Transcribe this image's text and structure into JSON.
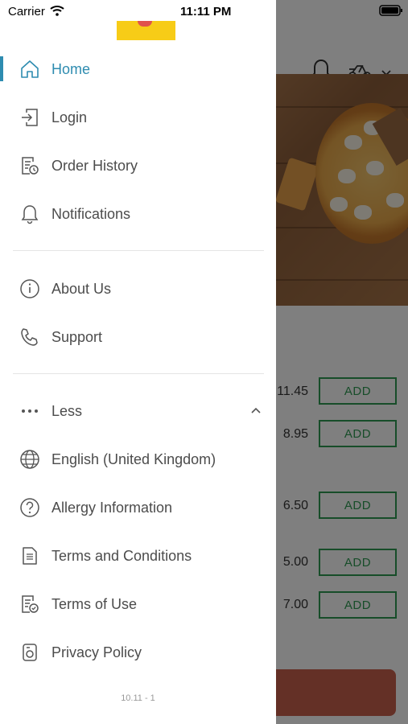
{
  "status_bar": {
    "carrier": "Carrier",
    "time": "11:11 PM"
  },
  "drawer": {
    "primary": [
      {
        "label": "Home",
        "icon": "home-icon",
        "active": true
      },
      {
        "label": "Login",
        "icon": "login-icon"
      },
      {
        "label": "Order History",
        "icon": "order-history-icon"
      },
      {
        "label": "Notifications",
        "icon": "bell-icon"
      }
    ],
    "secondary": [
      {
        "label": "About Us",
        "icon": "info-icon"
      },
      {
        "label": "Support",
        "icon": "phone-icon"
      }
    ],
    "more_toggle": {
      "label": "Less",
      "icon": "ellipsis-icon",
      "expanded": true
    },
    "more_items": [
      {
        "label": "English (United Kingdom)",
        "icon": "globe-icon"
      },
      {
        "label": "Allergy Information",
        "icon": "question-icon"
      },
      {
        "label": "Terms and Conditions",
        "icon": "document-icon"
      },
      {
        "label": "Terms of Use",
        "icon": "document-check-icon"
      },
      {
        "label": "Privacy Policy",
        "icon": "privacy-icon"
      }
    ],
    "version": "10.11 - 1",
    "accent_color": "#2e8cb0"
  },
  "background": {
    "menu_items": [
      {
        "price": "11.45",
        "button": "ADD"
      },
      {
        "price": "8.95",
        "button": "ADD"
      },
      {
        "price": "6.50",
        "button": "ADD"
      },
      {
        "price": "5.00",
        "button": "ADD"
      },
      {
        "price": "7.00",
        "button": "ADD"
      }
    ],
    "button_color": "#2f9a53",
    "cart_color": "#c9604d"
  }
}
